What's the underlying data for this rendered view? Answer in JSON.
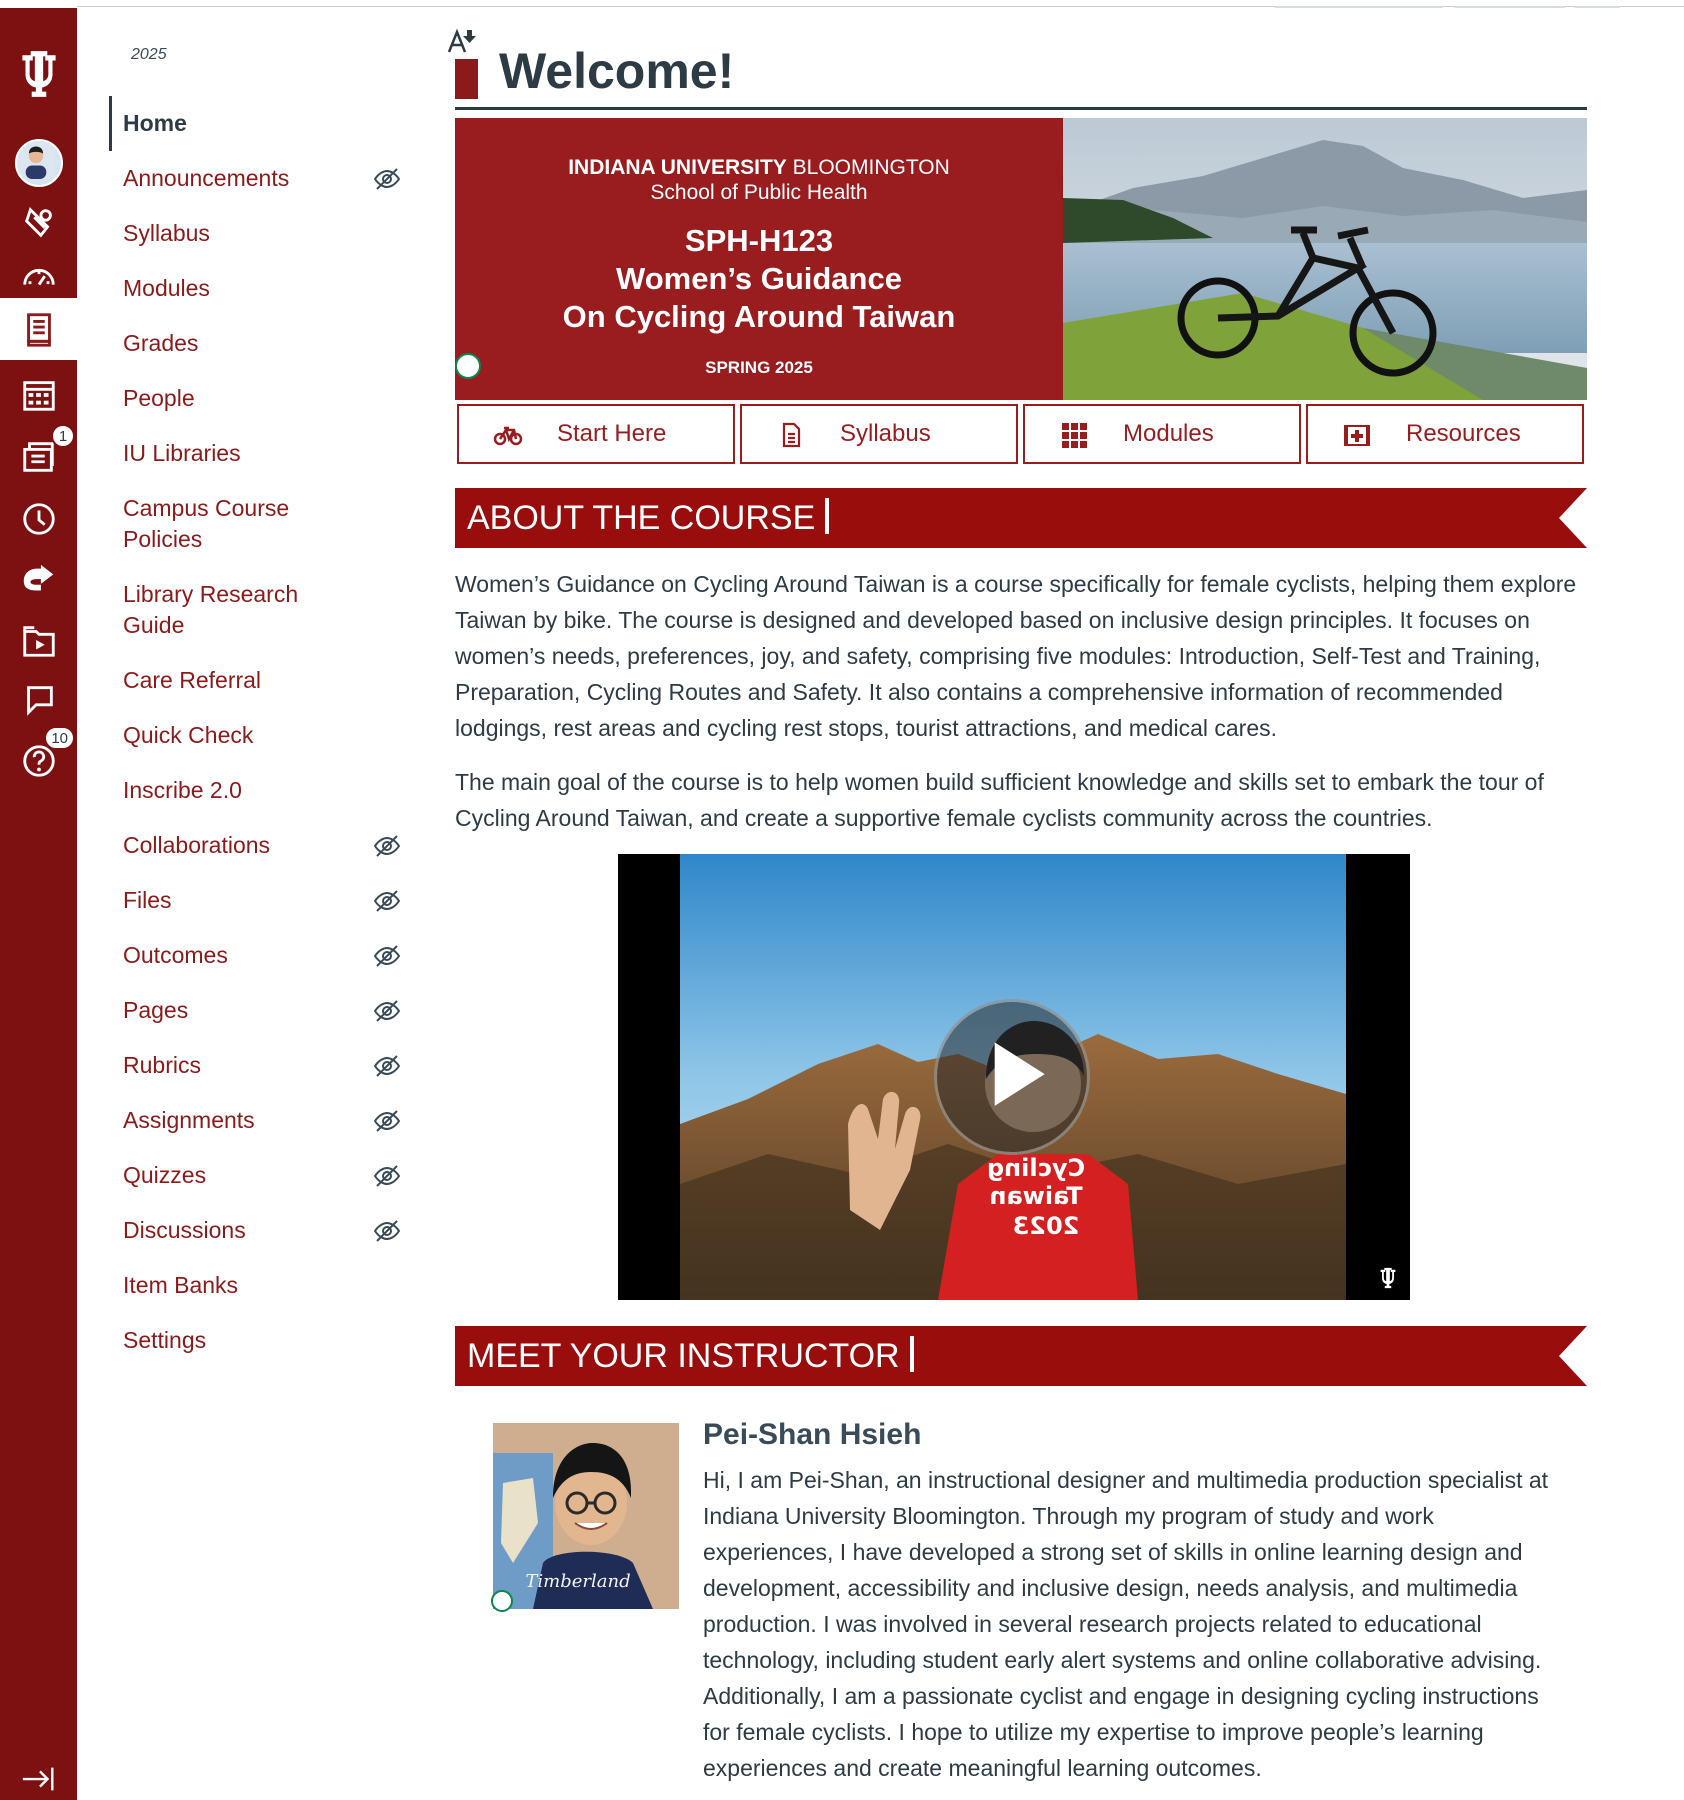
{
  "global_nav": {
    "todo_badge": "1",
    "help_badge": "10"
  },
  "course_nav": {
    "term": "2025",
    "items": [
      {
        "label": "Home"
      },
      {
        "label": "Announcements"
      },
      {
        "label": "Syllabus"
      },
      {
        "label": "Modules"
      },
      {
        "label": "Grades"
      },
      {
        "label": "People"
      },
      {
        "label": "IU Libraries"
      },
      {
        "label": "Campus Course Policies"
      },
      {
        "label": "Library Research Guide"
      },
      {
        "label": "Care Referral"
      },
      {
        "label": "Quick Check"
      },
      {
        "label": "Inscribe 2.0"
      },
      {
        "label": "Collaborations"
      },
      {
        "label": "Files"
      },
      {
        "label": "Outcomes"
      },
      {
        "label": "Pages"
      },
      {
        "label": "Rubrics"
      },
      {
        "label": "Assignments"
      },
      {
        "label": "Quizzes"
      },
      {
        "label": "Discussions"
      },
      {
        "label": "Item Banks"
      },
      {
        "label": "Settings"
      }
    ]
  },
  "page": {
    "title": "Welcome!"
  },
  "banner": {
    "university_bold": "INDIANA UNIVERSITY",
    "university_rest": "BLOOMINGTON",
    "school": "School of Public Health",
    "course_code": "SPH-H123",
    "course_title_1": "Women’s Guidance",
    "course_title_2": "On Cycling Around Taiwan",
    "term": "SPRING 2025"
  },
  "quick_links": {
    "start_here": "Start Here",
    "syllabus": "Syllabus",
    "modules": "Modules",
    "resources": "Resources"
  },
  "about": {
    "heading": "ABOUT THE COURSE",
    "para1": "Women’s Guidance on Cycling Around Taiwan is a course specifically for female cyclists, helping them explore Taiwan by bike. The course is designed and developed based on inclusive design principles. It focuses on women’s needs, preferences, joy, and safety, comprising five modules: Introduction, Self-Test and Training, Preparation, Cycling Routes and Safety. It also contains a comprehensive information of recommended lodgings, rest areas and cycling rest stops, tourist attractions, and medical cares.",
    "para2": "The main goal of the course is to help women build sufficient knowledge and skills set to embark the tour of Cycling Around Taiwan, and create a supportive female cyclists community across the countries."
  },
  "video": {
    "shirt_line1": "Cycling",
    "shirt_line2": "Taiwan",
    "shirt_line3": "2023"
  },
  "instructor": {
    "heading": "MEET YOUR INSTRUCTOR",
    "name": "Pei-Shan Hsieh",
    "shirt_text": "Timberland",
    "bio": "Hi, I am Pei-Shan, an instructional designer and multimedia production specialist at Indiana University Bloomington. Through my program of study and work experiences, I have developed a strong set of skills in online learning design and development, accessibility and inclusive design, needs analysis, and multimedia production. I was involved in several research projects related to educational technology, including student early alert systems and online collaborative advising. Additionally, I am a passionate cyclist and engage in designing cycling instructions for female cyclists. I hope to utilize my expertise to improve people’s learning experiences and create meaningful learning outcomes."
  },
  "colors": {
    "nav_bg": "#7d1111",
    "brand_red": "#991c1f",
    "link_red": "#8b1a1a",
    "text": "#2d3b45"
  }
}
